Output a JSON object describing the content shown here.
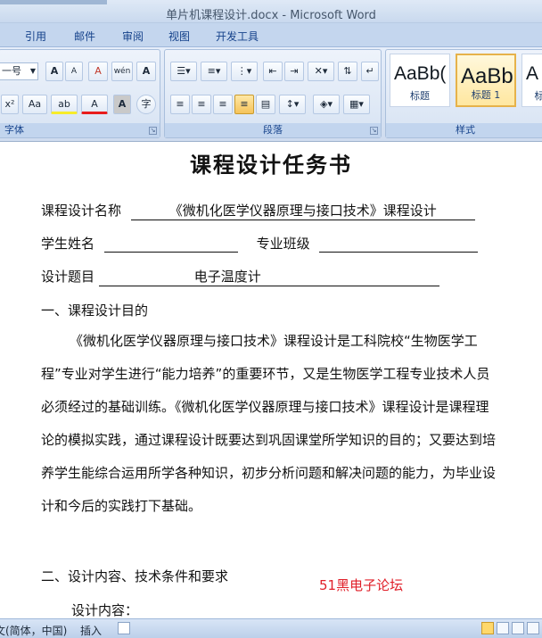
{
  "window": {
    "title": "单片机课程设计.docx - Microsoft Word"
  },
  "tabs": [
    "引用",
    "邮件",
    "审阅",
    "视图",
    "开发工具"
  ],
  "ribbon": {
    "font_group": {
      "label": "字体",
      "size_value": "一号",
      "grow_font": "A",
      "shrink_font": "A",
      "clear_format": "A",
      "phonetic": "wén",
      "char_border": "A",
      "superscript": "x²",
      "change_case": "Aa",
      "highlight": "ab",
      "font_color": "A",
      "char_shading": "A",
      "enclose": "字"
    },
    "paragraph_group": {
      "label": "段落"
    },
    "styles_group": {
      "label": "样式",
      "items": [
        {
          "sample": "AaBb(",
          "name": "标题"
        },
        {
          "sample": "AaBb",
          "name": "标题 1"
        },
        {
          "sample": "A",
          "name": "标"
        }
      ]
    }
  },
  "document": {
    "title": "课程设计任务书",
    "fields": {
      "course_name_label": "课程设计名称",
      "course_name_value": "《微机化医学仪器原理与接口技术》课程设计",
      "student_name_label": "学生姓名",
      "student_name_value": "",
      "class_label": "专业班级",
      "class_value": "",
      "topic_label": "设计题目",
      "topic_value": "电子温度计"
    },
    "section1_heading": "一、课程设计目的",
    "paragraph1": "《微机化医学仪器原理与接口技术》课程设计是工科院校“生物医学工程”专业对学生进行“能力培养”的重要环节，又是生物医学工程专业技术人员必须经过的基础训练。《微机化医学仪器原理与接口技术》课程设计是课程理论的模拟实践，通过课程设计既要达到巩固课堂所学知识的目的；又要达到培养学生能综合运用所学各种知识，初步分析问题和解决问题的能力，为毕业设计和今后的实践打下基础。",
    "section2_heading": "二、设计内容、技术条件和要求",
    "design_content_label": "设计内容：",
    "watermark": "51黑电子论坛"
  },
  "statusbar": {
    "language": "文(简体，中国)",
    "insert_mode": "插入"
  }
}
